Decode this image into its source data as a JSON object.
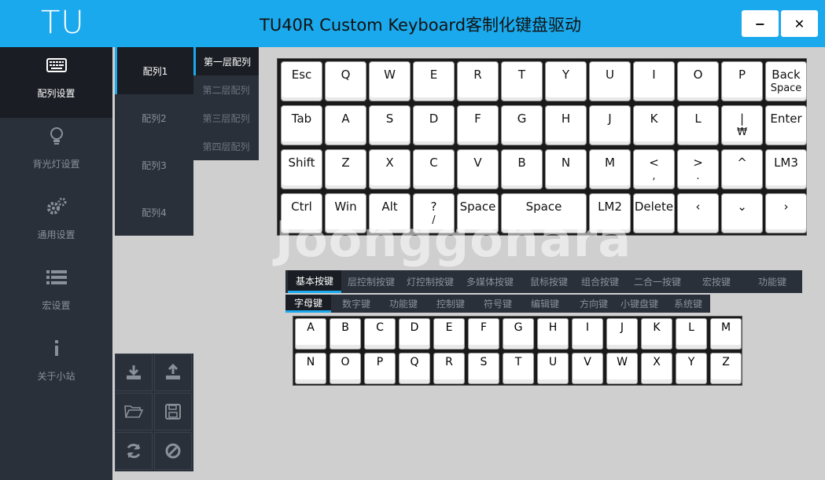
{
  "app": {
    "logo": "TU",
    "title": "TU40R Custom Keyboard客制化键盘驱动",
    "minimize": "−",
    "close": "✕"
  },
  "sidebar": {
    "items": [
      {
        "label": "配列设置",
        "icon": "keyboard-icon"
      },
      {
        "label": "背光灯设置",
        "icon": "bulb-icon"
      },
      {
        "label": "通用设置",
        "icon": "gears-icon"
      },
      {
        "label": "宏设置",
        "icon": "list-icon"
      },
      {
        "label": "关于小站",
        "icon": "info-icon"
      }
    ]
  },
  "layouts": [
    "配列1",
    "配列2",
    "配列3",
    "配列4"
  ],
  "layers": [
    "第一层配列",
    "第二层配列",
    "第三层配列",
    "第四层配列"
  ],
  "tools": [
    {
      "icon": "download-icon"
    },
    {
      "icon": "upload-icon"
    },
    {
      "icon": "folder-open-icon"
    },
    {
      "icon": "save-icon"
    },
    {
      "icon": "refresh-icon"
    },
    {
      "icon": "ban-icon"
    }
  ],
  "keyboard": {
    "rows": [
      [
        "Esc",
        "Q",
        "W",
        "E",
        "R",
        "T",
        "Y",
        "U",
        "I",
        "O",
        "P",
        "Back Space"
      ],
      [
        "Tab",
        "A",
        "S",
        "D",
        "F",
        "G",
        "H",
        "J",
        "K",
        "L",
        "| ₩",
        "Enter"
      ],
      [
        "Shift",
        "Z",
        "X",
        "C",
        "V",
        "B",
        "N",
        "M",
        "< ,",
        "> .",
        "^",
        "LM3"
      ],
      [
        "Ctrl",
        "Win",
        "Alt",
        "? /",
        "Space",
        "Space",
        "LM2",
        "Delete",
        "‹",
        "⌄",
        "›"
      ]
    ]
  },
  "watermark": "Joonggonara",
  "category_tabs": [
    "基本按键",
    "层控制按键",
    "灯控制按键",
    "多媒体按键",
    "鼠标按键",
    "组合按键",
    "二合一按键",
    "宏按键",
    "功能键"
  ],
  "sub_tabs": [
    "字母键",
    "数字键",
    "功能键",
    "控制键",
    "符号键",
    "编辑键",
    "方向键",
    "小键盘键",
    "系统键"
  ],
  "palette": {
    "row1": [
      "A",
      "B",
      "C",
      "D",
      "E",
      "F",
      "G",
      "H",
      "I",
      "J",
      "K",
      "L",
      "M"
    ],
    "row2": [
      "N",
      "O",
      "P",
      "Q",
      "R",
      "S",
      "T",
      "U",
      "V",
      "W",
      "X",
      "Y",
      "Z"
    ]
  }
}
